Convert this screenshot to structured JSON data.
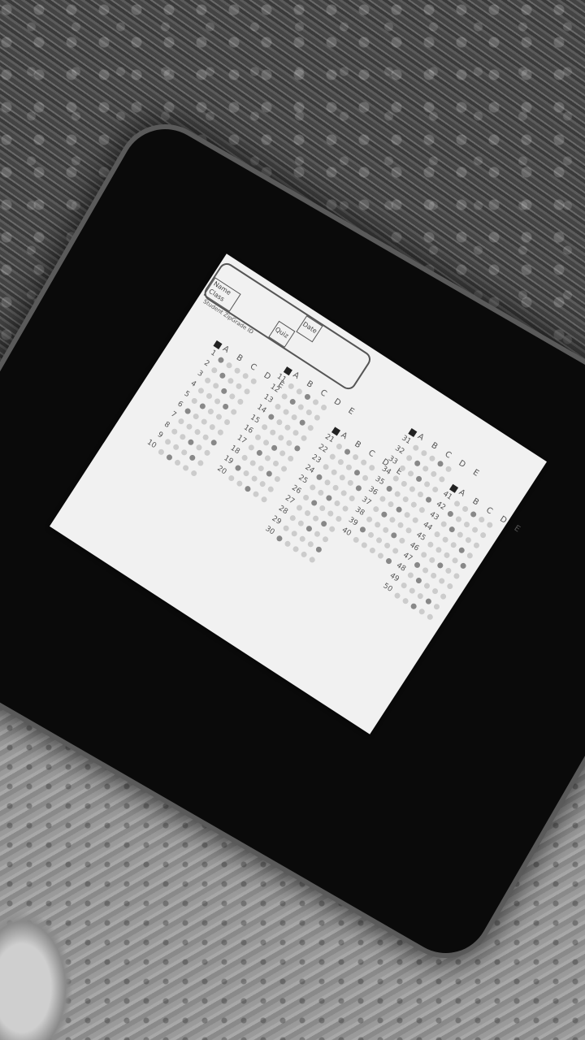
{
  "form": {
    "name_label": "Name",
    "class_label": "Class",
    "date_label": "Date",
    "quiz_label": "Quiz",
    "student_id_label": "Student ZipGrade ID"
  },
  "id_column": {
    "header": "A B C D E",
    "digits": [
      "1",
      "2",
      "3",
      "4",
      "5",
      "6",
      "7",
      "8",
      "9",
      "0"
    ]
  },
  "answer_columns": [
    {
      "header": "A B C D E",
      "start": 1,
      "end": 10
    },
    {
      "header": "A B C D E",
      "start": 11,
      "end": 20
    },
    {
      "header": "A B C D E",
      "start": 21,
      "end": 30
    },
    {
      "header": "A B C D E",
      "start": 31,
      "end": 40
    },
    {
      "header": "A B C D E",
      "start": 41,
      "end": 50
    }
  ],
  "filled": {
    "1": 0,
    "2": 1,
    "3": 2,
    "4": 3,
    "5": 1,
    "6": 0,
    "7": 4,
    "8": 2,
    "9": 3,
    "10": 1,
    "11": 2,
    "12": 1,
    "13": 3,
    "14": 0,
    "15": 4,
    "16": 2,
    "17": 1,
    "18": 3,
    "19": 0,
    "20": 2,
    "21": 1,
    "22": 3,
    "23": 4,
    "24": 0,
    "25": 2,
    "26": 1,
    "27": 3,
    "28": 2,
    "29": 4,
    "30": 0,
    "31": 3,
    "32": 1,
    "33": 2,
    "34": 4,
    "35": 0,
    "36": 2,
    "37": 1,
    "38": 3,
    "39": 0,
    "40": 4,
    "41": 2,
    "42": 0,
    "43": 1,
    "44": 3,
    "45": 4,
    "46": 2,
    "47": 0,
    "48": 1,
    "49": 3,
    "50": 2
  }
}
